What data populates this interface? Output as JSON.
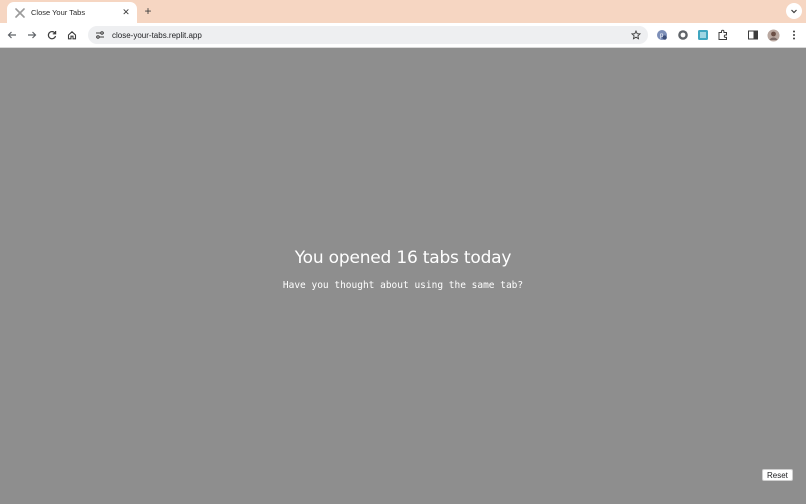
{
  "browser": {
    "tab": {
      "title": "Close Your Tabs",
      "favicon": "x-icon",
      "close_glyph": "✕"
    },
    "new_tab_glyph": "+",
    "tab_search_icon": "chevron-down-icon",
    "toolbar": {
      "back_icon": "arrow-left-icon",
      "forward_icon": "arrow-right-icon",
      "reload_icon": "reload-icon",
      "home_icon": "home-icon",
      "site_settings_icon": "tune-icon",
      "url": "close-your-tabs.replit.app",
      "bookmark_icon": "star-icon",
      "extensions": [
        "extension-1-icon",
        "extension-2-icon",
        "extension-3-icon",
        "puzzle-icon",
        "side-panel-icon",
        "profile-avatar",
        "kebab-menu-icon"
      ]
    },
    "colors": {
      "tabstrip_bg": "#f6d6c2",
      "toolbar_bg": "#ffffff",
      "omnibox_bg": "#eeeff1"
    }
  },
  "page": {
    "headline": "You opened 16 tabs today",
    "subline": "Have you thought about using the same tab?",
    "reset_label": "Reset",
    "background": "#8e8e8e"
  }
}
